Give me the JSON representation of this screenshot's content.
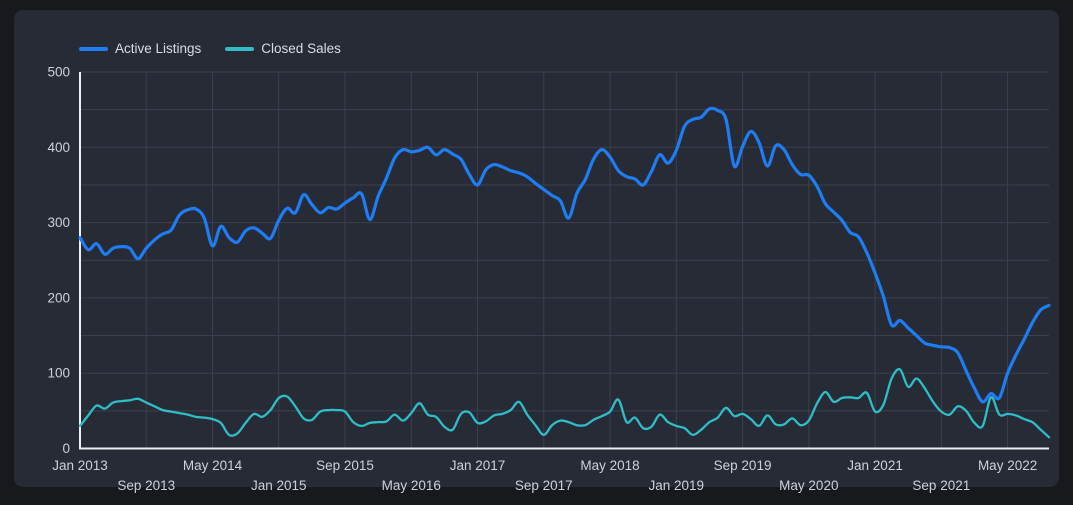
{
  "theme": {
    "page_bg": "#17191d",
    "card_bg": "#272b36",
    "grid_color": "#3b404d",
    "axis_color": "#edeff2",
    "tick_text_color": "#ccd1d9",
    "legend_text_color": "#d9dde3"
  },
  "legend": {
    "items": [
      {
        "label": "Active Listings",
        "color": "#1e7df2"
      },
      {
        "label": "Closed Sales",
        "color": "#2fbdc9"
      }
    ]
  },
  "chart_data": {
    "type": "line",
    "title": "",
    "xlabel": "",
    "ylabel": "",
    "x_start": "Jan 2013",
    "x_end": "Oct 2022",
    "x_interval": "monthly",
    "x_tick_interval_months": 8,
    "x_tick_labels": [
      "Jan 2013",
      "Sep 2013",
      "May 2014",
      "Jan 2015",
      "Sep 2015",
      "May 2016",
      "Jan 2017",
      "Sep 2017",
      "May 2018",
      "Jan 2019",
      "Sep 2019",
      "May 2020",
      "Jan 2021",
      "Sep 2021",
      "May 2022"
    ],
    "y_tick_labels": [
      "0",
      "100",
      "200",
      "300",
      "400",
      "500"
    ],
    "ylim": [
      0,
      500
    ],
    "y_grid_interval": 50,
    "grid": true,
    "legend_position": "top-left",
    "series": [
      {
        "name": "Active Listings",
        "color": "#1e7df2",
        "line_width": 3.2,
        "values": [
          280,
          264,
          272,
          258,
          266,
          268,
          266,
          252,
          266,
          277,
          285,
          290,
          310,
          317,
          318,
          306,
          269,
          295,
          280,
          274,
          289,
          293,
          286,
          279,
          303,
          319,
          313,
          337,
          324,
          313,
          320,
          318,
          326,
          333,
          338,
          304,
          335,
          359,
          386,
          397,
          394,
          396,
          400,
          390,
          397,
          391,
          384,
          364,
          350,
          370,
          377,
          374,
          369,
          366,
          361,
          352,
          344,
          336,
          329,
          306,
          339,
          357,
          384,
          397,
          387,
          369,
          361,
          358,
          350,
          368,
          390,
          379,
          396,
          428,
          437,
          440,
          451,
          449,
          437,
          375,
          401,
          421,
          406,
          375,
          402,
          397,
          377,
          364,
          363,
          348,
          325,
          314,
          303,
          287,
          281,
          260,
          233,
          202,
          164,
          170,
          160,
          150,
          140,
          137,
          135,
          134,
          127,
          103,
          80,
          62,
          73,
          67,
          100,
          124,
          145,
          167,
          184,
          190
        ]
      },
      {
        "name": "Closed Sales",
        "color": "#2fbdc9",
        "line_width": 2.3,
        "values": [
          30,
          44,
          57,
          53,
          61,
          63,
          64,
          66,
          61,
          56,
          51,
          49,
          47,
          45,
          42,
          41,
          39,
          34,
          18,
          20,
          34,
          46,
          42,
          51,
          67,
          69,
          56,
          40,
          38,
          49,
          51,
          51,
          49,
          35,
          30,
          34,
          35,
          36,
          45,
          37,
          47,
          60,
          45,
          42,
          29,
          25,
          46,
          48,
          34,
          36,
          44,
          46,
          51,
          62,
          45,
          31,
          18,
          31,
          37,
          35,
          31,
          31,
          38,
          43,
          49,
          65,
          35,
          41,
          27,
          29,
          45,
          35,
          30,
          27,
          18,
          25,
          35,
          41,
          54,
          43,
          46,
          39,
          30,
          44,
          32,
          32,
          40,
          31,
          37,
          60,
          75,
          62,
          67,
          68,
          67,
          74,
          49,
          58,
          93,
          105,
          82,
          93,
          80,
          62,
          49,
          45,
          56,
          50,
          34,
          30,
          68,
          45,
          46,
          44,
          39,
          35,
          25,
          15
        ]
      }
    ]
  }
}
